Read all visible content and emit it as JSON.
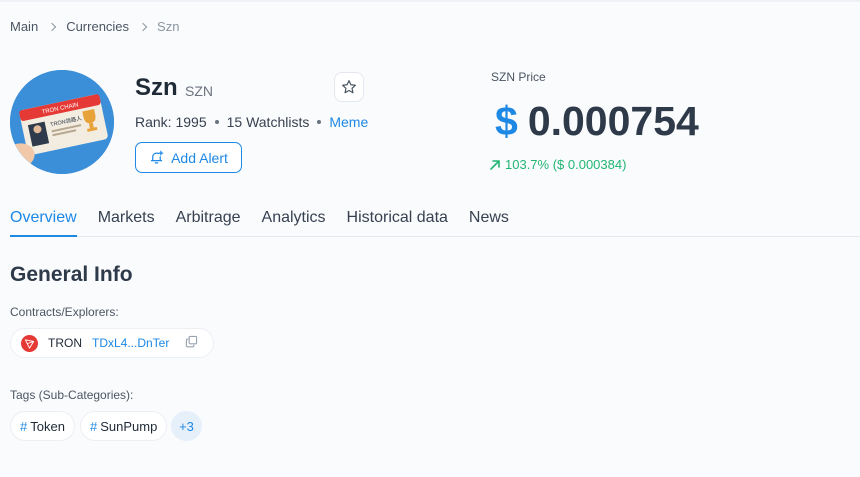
{
  "breadcrumb": [
    "Main",
    "Currencies",
    "Szn"
  ],
  "coin": {
    "name": "Szn",
    "symbol": "SZN",
    "rank_text": "Rank: 1995",
    "watchlists_text": "15 Watchlists",
    "category": "Meme",
    "add_alert_label": "Add Alert",
    "avatar_card_text": "TRON CHAIN",
    "avatar_card_text2": "TRON领路人"
  },
  "price": {
    "label": "SZN Price",
    "currency": "$",
    "value": "0.000754",
    "change_text": "103.7% ($ 0.000384)",
    "change_color": "#22b573"
  },
  "tabs": [
    {
      "label": "Overview",
      "active": true
    },
    {
      "label": "Markets",
      "active": false
    },
    {
      "label": "Arbitrage",
      "active": false
    },
    {
      "label": "Analytics",
      "active": false
    },
    {
      "label": "Historical data",
      "active": false
    },
    {
      "label": "News",
      "active": false
    }
  ],
  "general": {
    "title": "General Info",
    "contracts_label": "Contracts/Explorers:",
    "contract": {
      "chain": "TRON",
      "address": "TDxL4...DnTer"
    },
    "tags_label": "Tags (Sub-Categories):",
    "tags": [
      "Token",
      "SunPump"
    ],
    "more_tags": "+3"
  },
  "colors": {
    "accent": "#1e88e5",
    "positive": "#22b573",
    "text": "#2e3a4a"
  }
}
